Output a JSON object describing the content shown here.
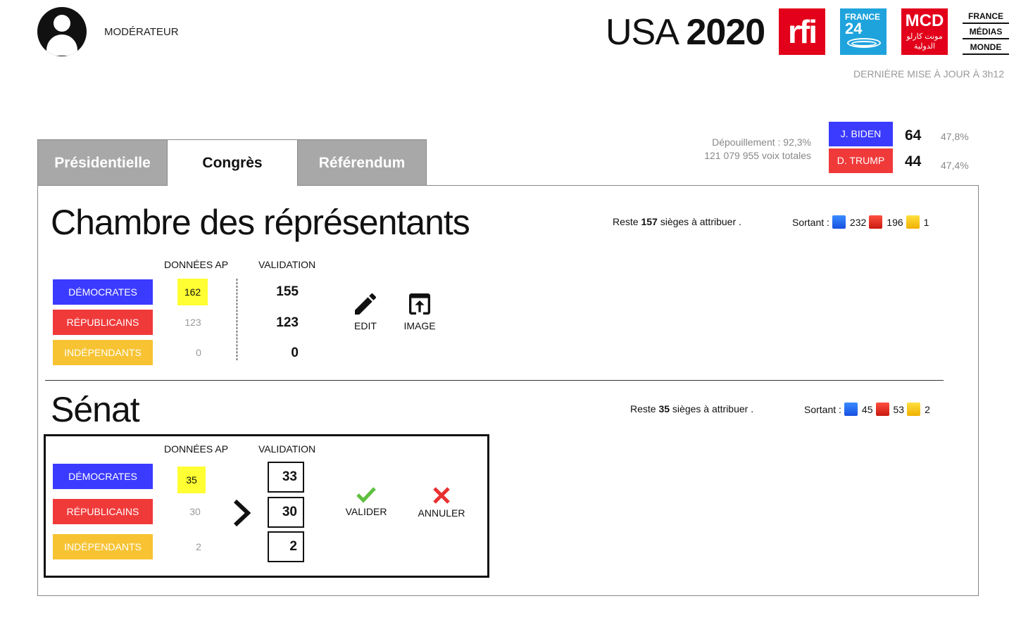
{
  "header": {
    "role": "MODÉRATEUR",
    "title_light": "USA",
    "title_bold": "2020",
    "updated": "DERNIÈRE MISE À JOUR À 3h12",
    "logos": {
      "rfi": "rfi",
      "france24_line1": "FRANCE",
      "france24_line2": "24",
      "mcd_line1": "MCD",
      "mcd_line2": "مونت كارلو",
      "mcd_line3": "الدولية",
      "fmm_line1": "FRANCE",
      "fmm_line2": "MÉDIAS",
      "fmm_line3": "MONDE"
    }
  },
  "summary": {
    "depouillement": "Dépouillement : 92,3%",
    "total_votes": "121 079 955 voix totales",
    "candidates": [
      {
        "name": "J. BIDEN",
        "votes": "64",
        "pct": "47,8%",
        "color": "#3b3bff"
      },
      {
        "name": "D. TRUMP",
        "votes": "44",
        "pct": "47,4%",
        "color": "#f03a3a"
      }
    ]
  },
  "tabs": [
    {
      "label": "Présidentielle",
      "active": false
    },
    {
      "label": "Congrès",
      "active": true
    },
    {
      "label": "Référendum",
      "active": false
    }
  ],
  "chambre": {
    "title": "Chambre des réprésentants",
    "reste_prefix": "Reste ",
    "reste_value": "157",
    "reste_suffix": " sièges à attribuer .",
    "sortant_label": "Sortant :",
    "sortant": [
      "232",
      "196",
      "1"
    ],
    "col_ap": "DONNÉES AP",
    "col_validation": "VALIDATION",
    "rows": [
      {
        "party": "DÉMOCRATES",
        "ap": "162",
        "validation": "155"
      },
      {
        "party": "RÉPUBLICAINS",
        "ap": "123",
        "validation": "123"
      },
      {
        "party": "INDÉPENDANTS",
        "ap": "0",
        "validation": "0"
      }
    ],
    "actions": {
      "edit": "EDIT",
      "image": "IMAGE"
    }
  },
  "senat": {
    "title": "Sénat",
    "reste_prefix": "Reste ",
    "reste_value": "35",
    "reste_suffix": " sièges à attribuer .",
    "sortant_label": "Sortant :",
    "sortant": [
      "45",
      "53",
      "2"
    ],
    "col_ap": "DONNÉES AP",
    "col_validation": "VALIDATION",
    "rows": [
      {
        "party": "DÉMOCRATES",
        "ap": "35",
        "validation": "33"
      },
      {
        "party": "RÉPUBLICAINS",
        "ap": "30",
        "validation": "30"
      },
      {
        "party": "INDÉPENDANTS",
        "ap": "2",
        "validation": "2"
      }
    ],
    "actions": {
      "valider": "VALIDER",
      "annuler": "ANNULER"
    }
  },
  "colors": {
    "democrat": "#3b3bff",
    "republican": "#f03a3a",
    "independent": "#f7c333",
    "highlight": "#ffff33",
    "valider": "#5fbf3f",
    "annuler": "#e83030"
  }
}
